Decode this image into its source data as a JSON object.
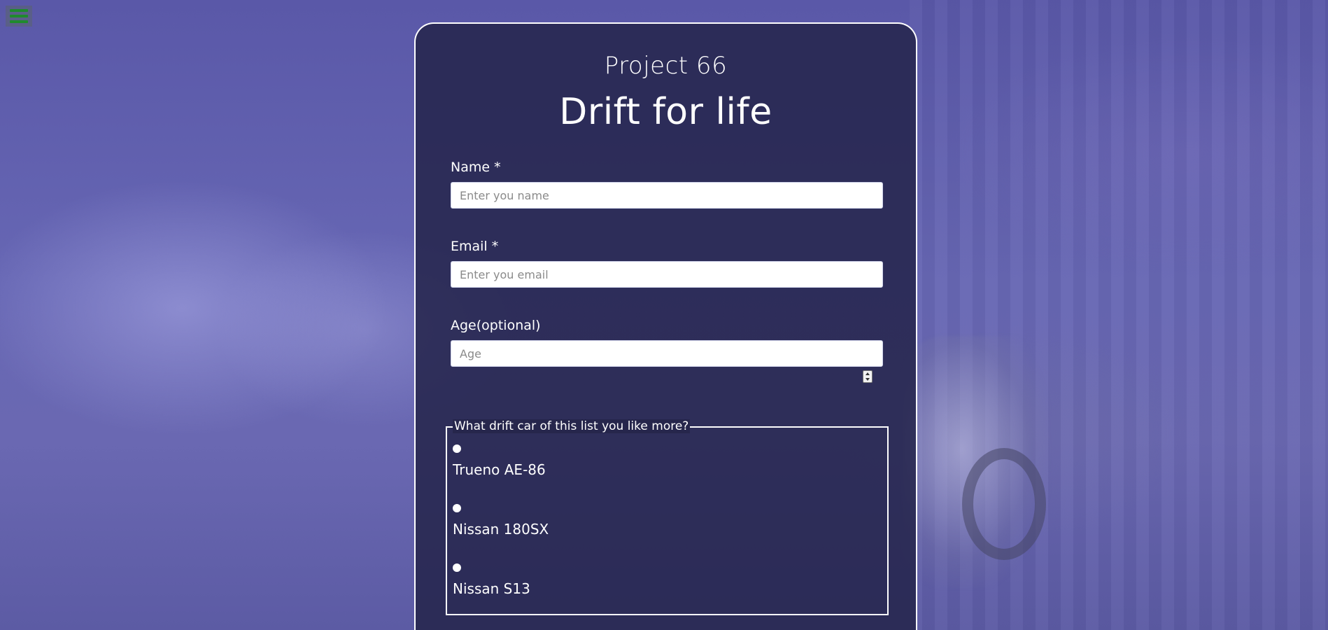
{
  "header": {
    "menu_icon": "hamburger-menu-icon",
    "menu_color": "#1f8a2e"
  },
  "form": {
    "project_label": "Project 66",
    "title": "Drift for life",
    "fields": {
      "name": {
        "label": "Name *",
        "placeholder": "Enter you name",
        "value": ""
      },
      "email": {
        "label": "Email *",
        "placeholder": "Enter you email",
        "value": ""
      },
      "age": {
        "label": "Age(optional)",
        "placeholder": "Age",
        "value": ""
      }
    },
    "car_question": {
      "legend": "What drift car of this list you like more?",
      "options": [
        {
          "label": "Trueno AE-86"
        },
        {
          "label": "Nissan 180SX"
        },
        {
          "label": "Nissan S13"
        }
      ]
    }
  },
  "colors": {
    "card_background": "#26264c",
    "page_background": "#6565b0",
    "text": "#ffffff"
  }
}
